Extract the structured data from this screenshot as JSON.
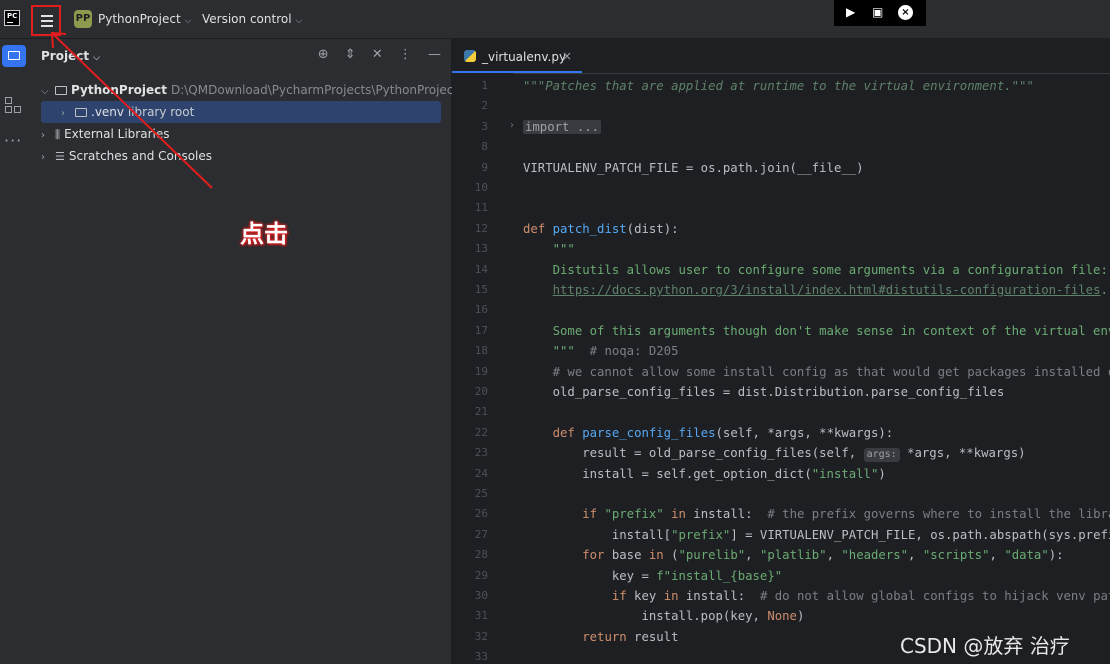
{
  "titlebar": {
    "logo_text": "PC",
    "project_badge": "PP",
    "project_name": "PythonProject",
    "version_control": "Version control"
  },
  "panel": {
    "title": "Project",
    "tree": [
      {
        "label": "PythonProject",
        "path": "D:\\QMDownload\\PycharmProjects\\PythonProject"
      },
      {
        "label": ".venv",
        "suffix": "library root"
      },
      {
        "label": "External Libraries"
      },
      {
        "label": "Scratches and Consoles"
      }
    ]
  },
  "annotation": {
    "text": "点击"
  },
  "editor": {
    "tab": {
      "label": "_virtualenv.py"
    },
    "line_numbers": [
      "1",
      "2",
      "3",
      "8",
      "9",
      "10",
      "11",
      "12",
      "13",
      "14",
      "15",
      "16",
      "17",
      "18",
      "19",
      "20",
      "21",
      "22",
      "23",
      "24",
      "25",
      "26",
      "27",
      "28",
      "29",
      "30",
      "31",
      "32",
      "33"
    ],
    "lines": [
      "\"\"\"Patches that are applied at runtime to the virtual environment.\"\"\"",
      "",
      "import ...",
      "",
      "VIRTUALENV_PATCH_FILE = os.path.join(__file__)",
      "",
      "",
      "def patch_dist(dist):",
      "    \"\"\"",
      "    Distutils allows user to configure some arguments via a configuration file:",
      "    https://docs.python.org/3/install/index.html#distutils-configuration-files.",
      "",
      "    Some of this arguments though don't make sense in context of the virtual env",
      "    \"\"\"  # noqa: D205",
      "    # we cannot allow some install config as that would get packages installed o",
      "    old_parse_config_files = dist.Distribution.parse_config_files",
      "",
      "    def parse_config_files(self, *args, **kwargs):",
      "        result = old_parse_config_files(self, args: *args, **kwargs)",
      "        install = self.get_option_dict(\"install\")",
      "",
      "        if \"prefix\" in install:  # the prefix governs where to install the libra",
      "            install[\"prefix\"] = VIRTUALENV_PATCH_FILE, os.path.abspath(sys.prefi",
      "        for base in (\"purelib\", \"platlib\", \"headers\", \"scripts\", \"data\"):",
      "            key = f\"install_{base}\"",
      "            if key in install:  # do not allow global configs to hijack venv pat",
      "                install.pop(key, None)",
      "        return result",
      ""
    ],
    "hint": "args:"
  },
  "watermark": {
    "text": "CSDN @放弃      治疗"
  }
}
